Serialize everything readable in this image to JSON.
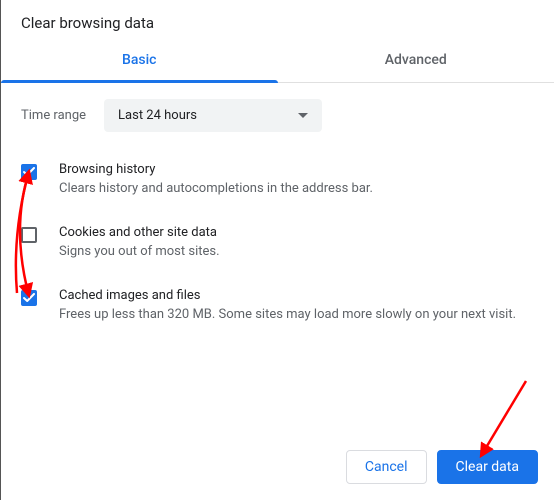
{
  "dialog": {
    "title": "Clear browsing data"
  },
  "tabs": {
    "basic": "Basic",
    "advanced": "Advanced",
    "active": "basic"
  },
  "time_range": {
    "label": "Time range",
    "value": "Last 24 hours"
  },
  "options": [
    {
      "id": "browsing-history",
      "title": "Browsing history",
      "description": "Clears history and autocompletions in the address bar.",
      "checked": true
    },
    {
      "id": "cookies",
      "title": "Cookies and other site data",
      "description": "Signs you out of most sites.",
      "checked": false
    },
    {
      "id": "cache",
      "title": "Cached images and files",
      "description": "Frees up less than 320 MB. Some sites may load more slowly on your next visit.",
      "checked": true
    }
  ],
  "buttons": {
    "cancel": "Cancel",
    "clear": "Clear data"
  },
  "colors": {
    "accent": "#1a73e8",
    "text_primary": "#202124",
    "text_secondary": "#5f6368",
    "annotation_arrow": "#ff0000"
  }
}
